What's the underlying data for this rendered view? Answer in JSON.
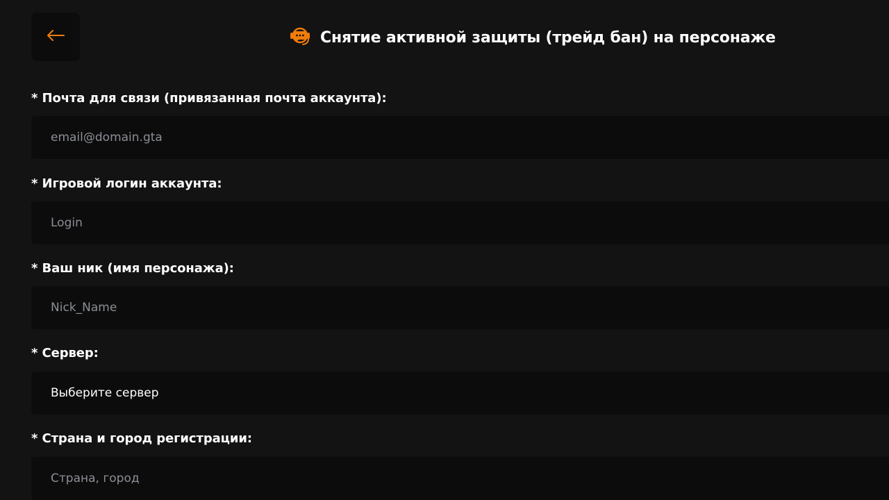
{
  "header": {
    "title": "Снятие активной защиты (трейд бан) на персонаже",
    "icon": "support-chat-icon",
    "back_icon": "arrow-left-icon",
    "accent_color": "#f07d0a"
  },
  "form": {
    "email": {
      "label": "* Почта для связи (привязанная почта аккаунта):",
      "placeholder": "email@domain.gta"
    },
    "login": {
      "label": "* Игровой логин аккаунта:",
      "placeholder": "Login"
    },
    "nick": {
      "label": "* Ваш ник (имя персонажа):",
      "placeholder": "Nick_Name"
    },
    "server": {
      "label": "* Сервер:",
      "selected": "Выберите сервер"
    },
    "location": {
      "label": "* Страна и город регистрации:",
      "placeholder": "Страна, город"
    }
  }
}
